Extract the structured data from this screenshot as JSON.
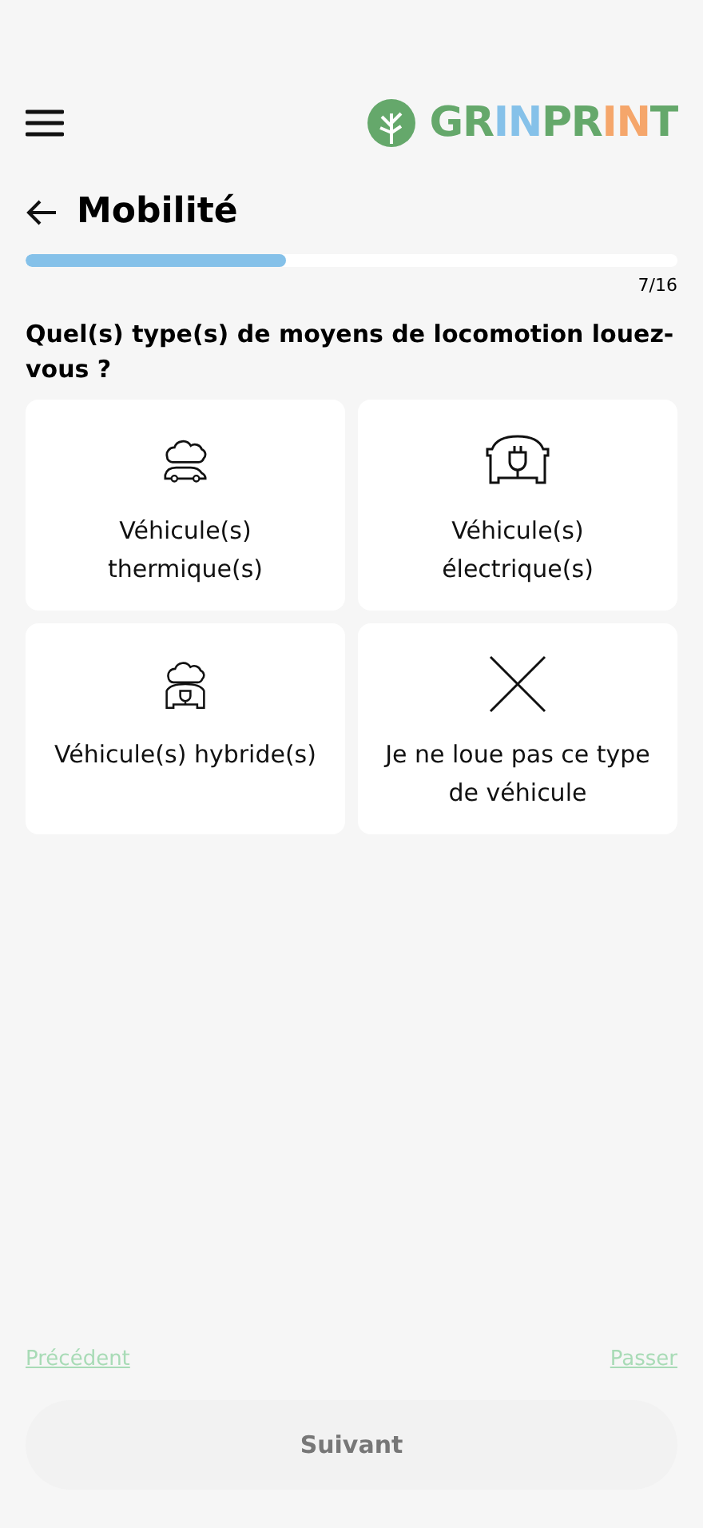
{
  "header": {
    "logo": [
      {
        "text": "GR",
        "color": "#65a86b"
      },
      {
        "text": "IN",
        "color": "#85c1e9"
      },
      {
        "text": "PR",
        "color": "#65a86b"
      },
      {
        "text": "IN",
        "color": "#f5a66b"
      },
      {
        "text": "T",
        "color": "#65a86b"
      }
    ]
  },
  "title": "Mobilité",
  "progress": {
    "level": 0.4,
    "reading": "7/16"
  },
  "question": "Quel(s) type(s) de moyens de locomotion louez-vous ?",
  "options": [
    {
      "kind": "thermal",
      "label": "Véhicule(s) thermique(s)",
      "selected": false
    },
    {
      "kind": "electric",
      "label": "Véhicule(s) électrique(s)",
      "selected": false
    },
    {
      "kind": "hybrid",
      "label": "Véhicule(s) hybride(s)",
      "selected": false
    },
    {
      "kind": "none",
      "label": "Je ne loue pas ce type de véhicule",
      "selected": false
    }
  ],
  "footer": {
    "previous": "Précédent",
    "skip": "Passer",
    "next": {
      "label": "Suivant",
      "disabled": true
    }
  }
}
